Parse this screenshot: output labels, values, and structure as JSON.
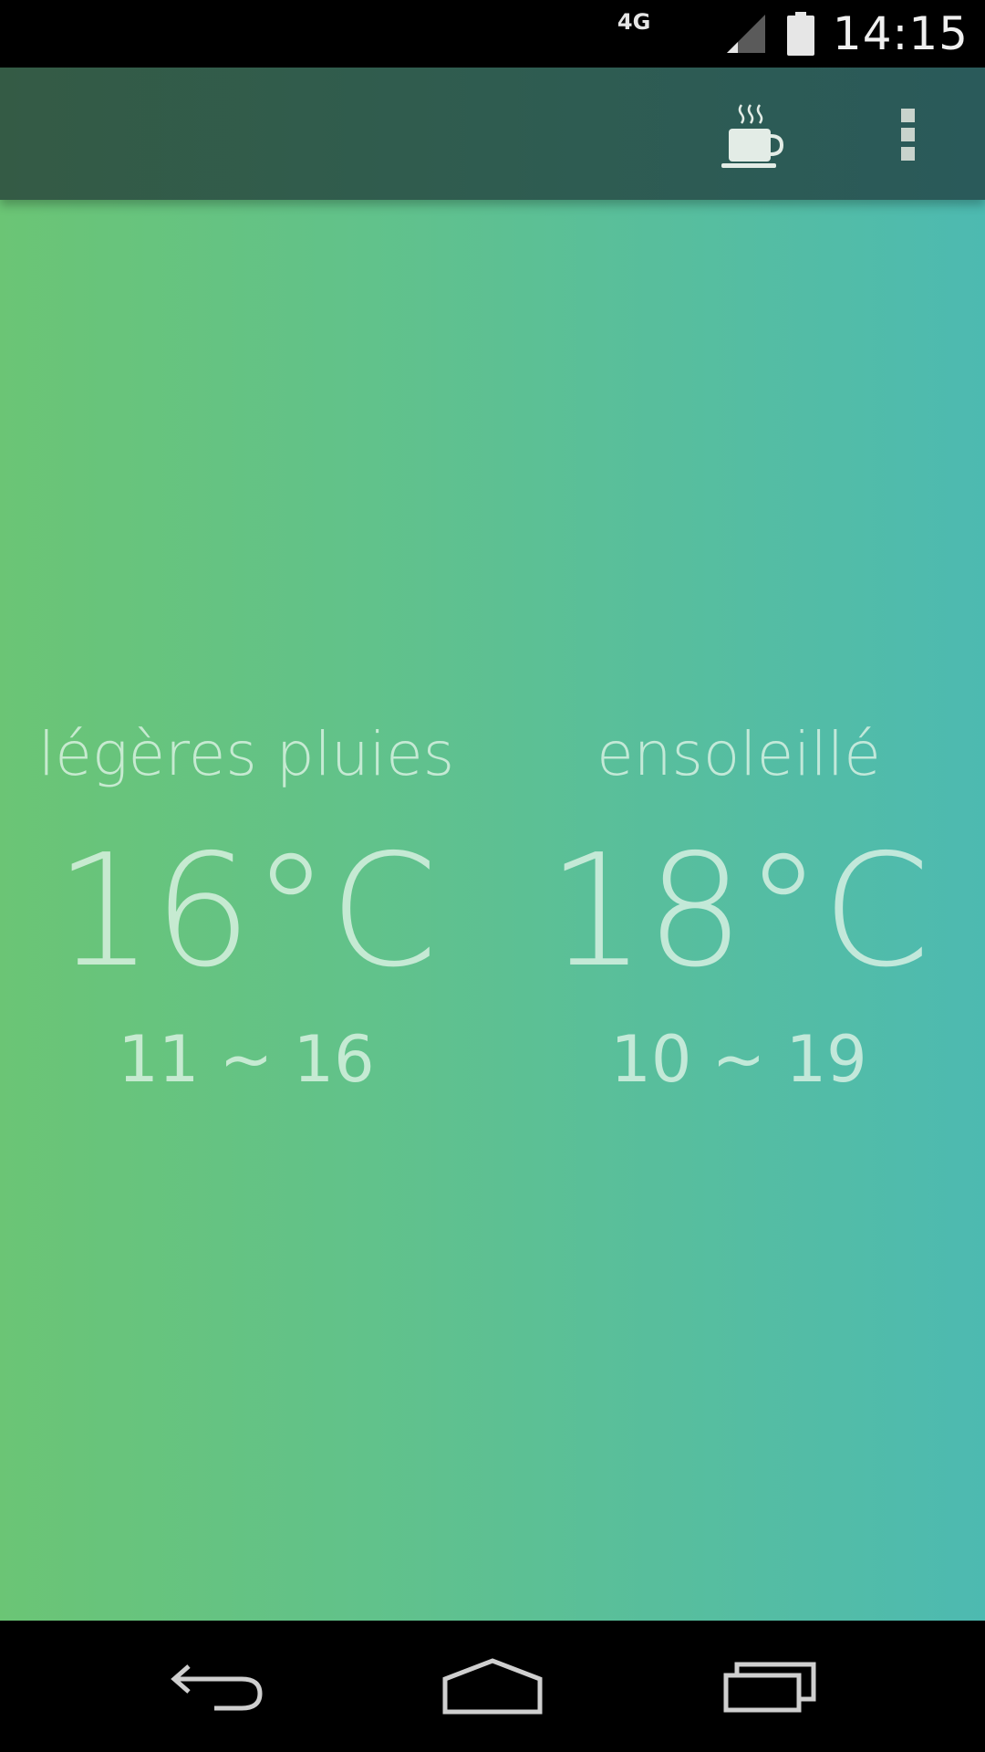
{
  "status_bar": {
    "network": "4G",
    "time": "14:15",
    "icons": [
      "signal-icon",
      "battery-icon"
    ]
  },
  "toolbar": {
    "actions": [
      "coffee-cup-icon",
      "overflow-menu-icon"
    ]
  },
  "forecasts": [
    {
      "condition": "légères pluies",
      "temperature": "16°C",
      "range": "11 ~ 16"
    },
    {
      "condition": "ensoleillé",
      "temperature": "18°C",
      "range": "10 ~ 19"
    }
  ],
  "navigation": {
    "buttons": [
      "back-icon",
      "home-icon",
      "recent-apps-icon"
    ]
  },
  "colors": {
    "gradient_start": "#6bc575",
    "gradient_end": "#4dbab1",
    "toolbar": "#2f5c50",
    "text": "#e1f5e8"
  }
}
